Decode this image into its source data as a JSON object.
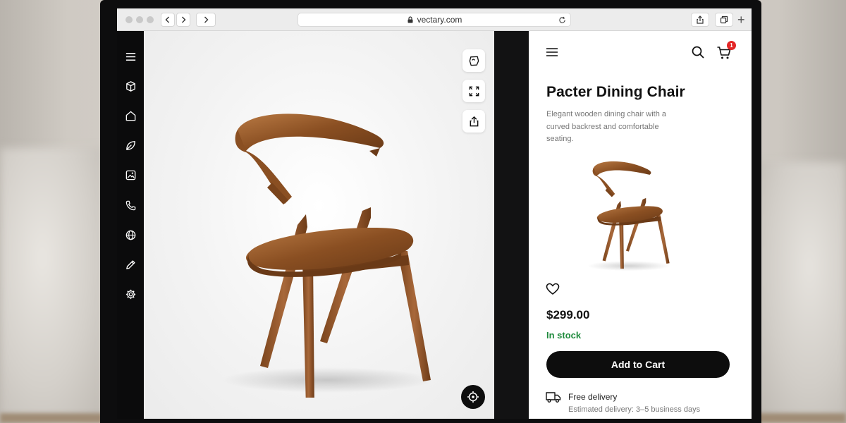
{
  "browser": {
    "url": "vectary.com",
    "back_icon": "chevron-left-icon",
    "forward_icon": "chevron-right-icon",
    "new_tab_label": "+"
  },
  "rail": {
    "icons": [
      "menu-icon",
      "cube-icon",
      "home-icon",
      "leaf-icon",
      "image-icon",
      "phone-icon",
      "globe-icon",
      "pencil-icon",
      "settings-icon"
    ]
  },
  "viewer": {
    "tools": [
      "ar-icon",
      "fullscreen-icon",
      "share-icon"
    ],
    "recenter_icon": "crosshair-icon"
  },
  "product": {
    "title": "Pacter Dining Chair",
    "description": "Elegant wooden dining chair with a curved backrest and comfortable seating.",
    "price": "$299.00",
    "stock": "In stock",
    "cart_count": "1",
    "add_to_cart": "Add to Cart",
    "delivery_title": "Free delivery",
    "delivery_sub": "Estimated delivery: 3–5 business days"
  },
  "colors": {
    "accent": "#0d0d0d",
    "stock_green": "#1e8a3c",
    "badge_red": "#e32626",
    "wood": "#8a4f22"
  }
}
